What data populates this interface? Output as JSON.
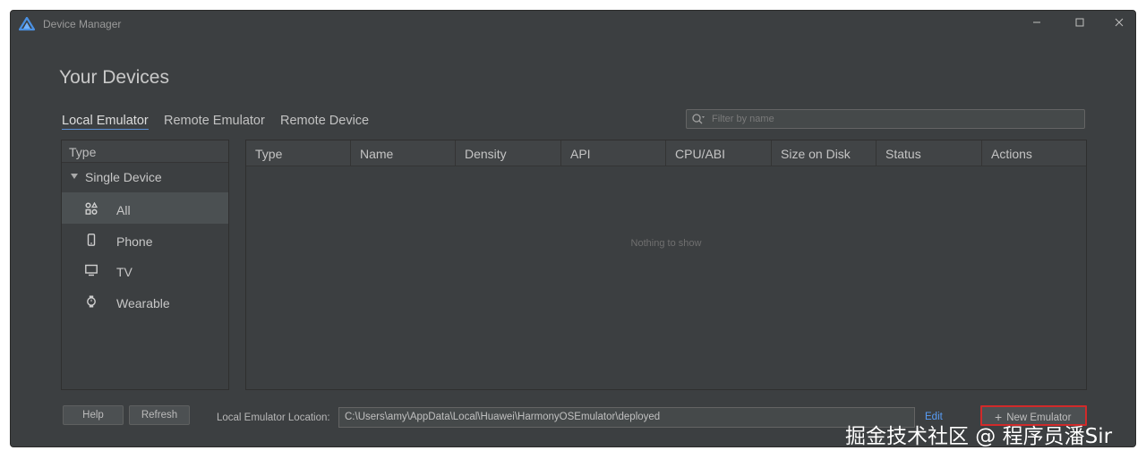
{
  "window": {
    "title": "Device Manager"
  },
  "page": {
    "heading": "Your Devices"
  },
  "tabs": [
    {
      "label": "Local Emulator",
      "active": true
    },
    {
      "label": "Remote Emulator",
      "active": false
    },
    {
      "label": "Remote Device",
      "active": false
    }
  ],
  "filter": {
    "placeholder": "Filter by name",
    "value": ""
  },
  "sidebar": {
    "header": "Type",
    "group": "Single Device",
    "items": [
      {
        "label": "All",
        "icon": "grid-shapes-icon",
        "selected": true
      },
      {
        "label": "Phone",
        "icon": "phone-icon",
        "selected": false
      },
      {
        "label": "TV",
        "icon": "tv-icon",
        "selected": false
      },
      {
        "label": "Wearable",
        "icon": "watch-icon",
        "selected": false
      }
    ]
  },
  "table": {
    "columns": [
      "Type",
      "Name",
      "Density",
      "API",
      "CPU/ABI",
      "Size on Disk",
      "Status",
      "Actions"
    ],
    "rows": [],
    "empty_text": "Nothing to show"
  },
  "footer": {
    "help_label": "Help",
    "refresh_label": "Refresh",
    "location_label": "Local Emulator Location:",
    "location_value": "C:\\Users\\amy\\AppData\\Local\\Huawei\\HarmonyOSEmulator\\deployed",
    "edit_label": "Edit",
    "new_emulator_label": "New Emulator"
  },
  "watermark": "掘金技术社区 @ 程序员潘Sir",
  "colors": {
    "background": "#3c3f41",
    "accent_link": "#589df6",
    "highlight_border": "#d12a2a",
    "selected_row": "#4b5052"
  }
}
